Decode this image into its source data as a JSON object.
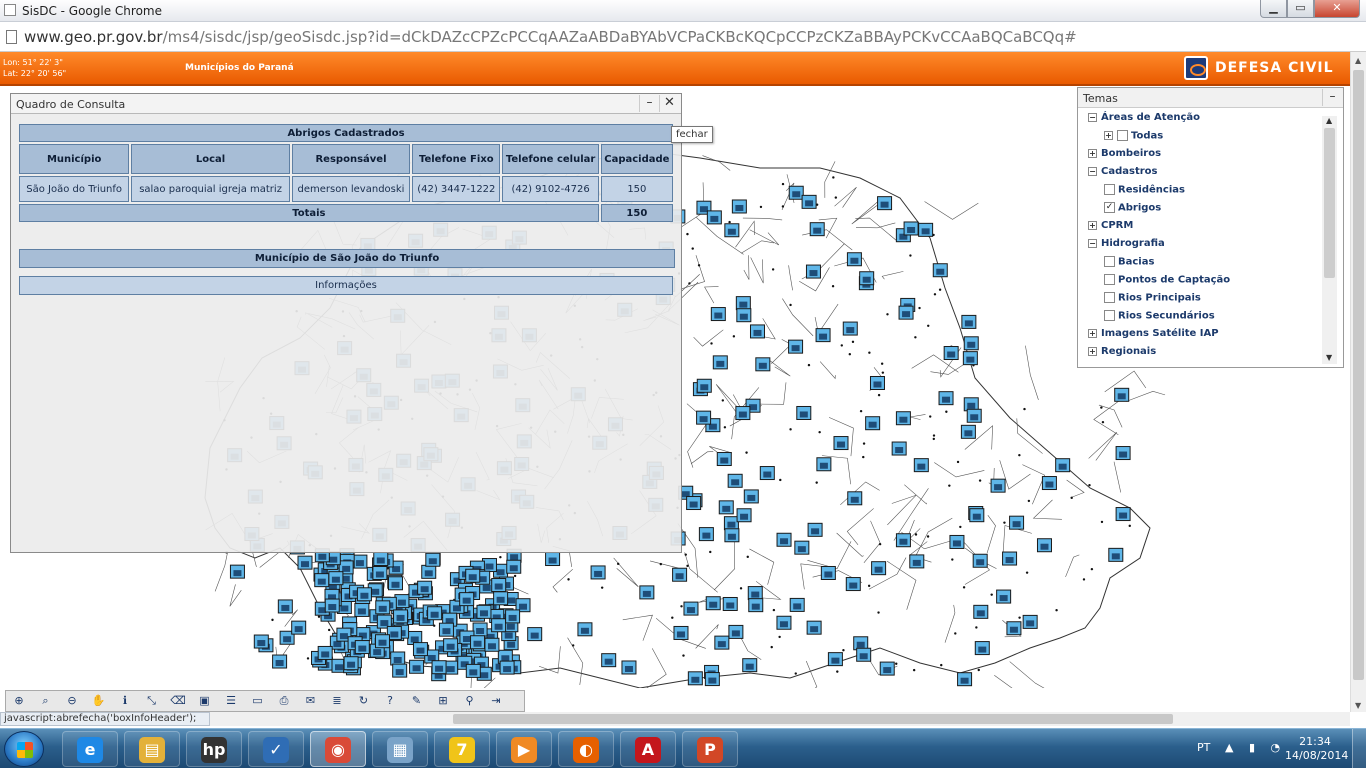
{
  "window": {
    "title": "SisDC - Google Chrome"
  },
  "browser": {
    "url_host": "www.geo.pr.gov.br",
    "url_path": "/ms4/sisdc/jsp/geoSisdc.jsp?id=dCkDAZcCPZcPCCqAAZaABDaBYAbVCPaCKBcKQCpCCPzCKZaBBAyPCKvCCAaBQCaBCQq#"
  },
  "app_header": {
    "lon": "Lon: 51° 22' 3\"",
    "lat": "Lat: 22° 20' 56\"",
    "title": "Municípios do Paraná",
    "logo_text": "DEFESA CIVIL",
    "color": "#f06a12"
  },
  "query_panel": {
    "title": "Quadro de Consulta",
    "close_tooltip": "fechar",
    "table_caption": "Abrigos Cadastrados",
    "columns": [
      "Município",
      "Local",
      "Responsável",
      "Telefone Fixo",
      "Telefone celular",
      "Capacidade"
    ],
    "rows": [
      {
        "municipio": "São João do Triunfo",
        "local": "salao paroquial igreja matriz",
        "responsavel": "demerson levandoski",
        "telefone_fixo": "(42) 3447-1222",
        "telefone_celular": "(42) 9102-4726",
        "capacidade": "150"
      }
    ],
    "totals_label": "Totais",
    "totals_value": "150",
    "municipio_heading": "Município de São João do Triunfo",
    "info_label": "Informações"
  },
  "temas": {
    "title": "Temas",
    "items": [
      {
        "label": "Áreas de Atenção",
        "level": 0,
        "expander": "−"
      },
      {
        "label": "Todas",
        "level": 1,
        "expander": "+",
        "checkbox": ""
      },
      {
        "label": "Bombeiros",
        "level": 0,
        "expander": "+"
      },
      {
        "label": "Cadastros",
        "level": 0,
        "expander": "−"
      },
      {
        "label": "Residências",
        "level": 1,
        "checkbox": ""
      },
      {
        "label": "Abrigos",
        "level": 1,
        "checkbox": "✓"
      },
      {
        "label": "CPRM",
        "level": 0,
        "expander": "+"
      },
      {
        "label": "Hidrografia",
        "level": 0,
        "expander": "−"
      },
      {
        "label": "Bacias",
        "level": 1,
        "checkbox": ""
      },
      {
        "label": "Pontos de Captação",
        "level": 1,
        "checkbox": ""
      },
      {
        "label": "Rios Principais",
        "level": 1,
        "checkbox": ""
      },
      {
        "label": "Rios Secundários",
        "level": 1,
        "checkbox": ""
      },
      {
        "label": "Imagens Satélite IAP",
        "level": 0,
        "expander": "+"
      },
      {
        "label": "Regionais",
        "level": 0,
        "expander": "+"
      }
    ]
  },
  "toolbar": {
    "tools": [
      {
        "name": "zoom-extent-tool",
        "glyph": "⊕"
      },
      {
        "name": "zoom-select-tool",
        "glyph": "⌕"
      },
      {
        "name": "zoom-out-tool",
        "glyph": "⊖"
      },
      {
        "name": "pan-tool",
        "glyph": "✋"
      },
      {
        "name": "info-tool",
        "glyph": "ℹ"
      },
      {
        "name": "measure-tool",
        "glyph": "⤡"
      },
      {
        "name": "eraser-tool",
        "glyph": "⌫"
      },
      {
        "name": "print-tool",
        "glyph": "▣"
      },
      {
        "name": "legend-tool",
        "glyph": "☰"
      },
      {
        "name": "layer-tool",
        "glyph": "▭"
      },
      {
        "name": "printer-tool",
        "glyph": "⎙"
      },
      {
        "name": "email-tool",
        "glyph": "✉"
      },
      {
        "name": "layers-tool",
        "glyph": "≣"
      },
      {
        "name": "refresh-tool",
        "glyph": "↻"
      },
      {
        "name": "help-tool",
        "glyph": "?"
      },
      {
        "name": "draw-tool",
        "glyph": "✎"
      },
      {
        "name": "report-tool",
        "glyph": "⊞"
      },
      {
        "name": "binoculars-tool",
        "glyph": "⚲"
      },
      {
        "name": "exit-tool",
        "glyph": "⇥"
      }
    ]
  },
  "status": {
    "text": "javascript:abrefecha('boxInfoHeader');"
  },
  "taskbar": {
    "apps": [
      {
        "name": "internet-explorer",
        "glyph": "e",
        "color": "#1e88e5"
      },
      {
        "name": "file-explorer",
        "glyph": "▤",
        "color": "#e3b13a"
      },
      {
        "name": "hp-app",
        "glyph": "hp",
        "color": "#333333"
      },
      {
        "name": "tasks-app",
        "glyph": "✓",
        "color": "#2f6db5"
      },
      {
        "name": "chrome",
        "glyph": "◉",
        "color": "#d94a38"
      },
      {
        "name": "calculator",
        "glyph": "▦",
        "color": "#7aa3c8"
      },
      {
        "name": "app-7",
        "glyph": "7",
        "color": "#f0c419"
      },
      {
        "name": "media-player",
        "glyph": "▶",
        "color": "#f08a24"
      },
      {
        "name": "firefox",
        "glyph": "◐",
        "color": "#e66000"
      },
      {
        "name": "adobe-reader",
        "glyph": "A",
        "color": "#c4161c"
      },
      {
        "name": "powerpoint",
        "glyph": "P",
        "color": "#d24726"
      }
    ],
    "language": "PT",
    "tray_icons": "▲ ▮ ◔",
    "time": "21:34",
    "date": "14/08/2014"
  }
}
